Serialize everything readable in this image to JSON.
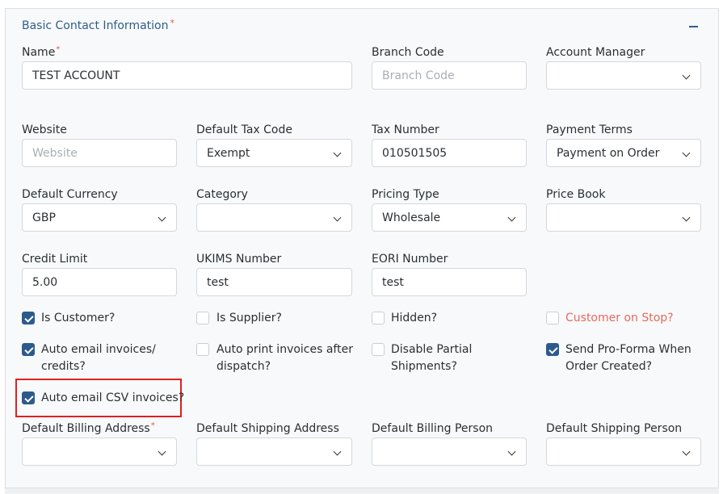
{
  "section": {
    "title": "Basic Contact Information",
    "required_mark": "*",
    "collapse_icon": "minus-icon"
  },
  "fields": {
    "name": {
      "label": "Name",
      "required_mark": "*",
      "value": "TEST ACCOUNT"
    },
    "branch_code": {
      "label": "Branch Code",
      "placeholder": "Branch Code"
    },
    "account_manager": {
      "label": "Account Manager",
      "value": ""
    },
    "website": {
      "label": "Website",
      "placeholder": "Website"
    },
    "default_tax_code": {
      "label": "Default Tax Code",
      "value": "Exempt"
    },
    "tax_number": {
      "label": "Tax Number",
      "value": "010501505"
    },
    "payment_terms": {
      "label": "Payment Terms",
      "value": "Payment on Order"
    },
    "default_currency": {
      "label": "Default Currency",
      "value": "GBP"
    },
    "category": {
      "label": "Category",
      "value": ""
    },
    "pricing_type": {
      "label": "Pricing Type",
      "value": "Wholesale"
    },
    "price_book": {
      "label": "Price Book",
      "value": ""
    },
    "credit_limit": {
      "label": "Credit Limit",
      "value": "5.00"
    },
    "ukims_number": {
      "label": "UKIMS Number",
      "value": "test"
    },
    "eori_number": {
      "label": "EORI Number",
      "value": "test"
    },
    "default_billing_address": {
      "label": "Default Billing Address",
      "required_mark": "*",
      "value": ""
    },
    "default_shipping_address": {
      "label": "Default Shipping Address",
      "value": ""
    },
    "default_billing_person": {
      "label": "Default Billing Person",
      "value": ""
    },
    "default_shipping_person": {
      "label": "Default Shipping Person",
      "value": ""
    }
  },
  "checkboxes": {
    "is_customer": {
      "label": "Is Customer?",
      "checked": true
    },
    "is_supplier": {
      "label": "Is Supplier?",
      "checked": false
    },
    "hidden": {
      "label": "Hidden?",
      "checked": false
    },
    "customer_on_stop": {
      "label": "Customer on Stop?",
      "checked": false
    },
    "auto_email_invoices": {
      "line1": "Auto email invoices/",
      "line2": "credits?",
      "checked": true
    },
    "auto_print_invoices": {
      "line1": "Auto print invoices after",
      "line2": "dispatch?",
      "checked": false
    },
    "disable_partial_shipments": {
      "line1": "Disable Partial",
      "line2": "Shipments?",
      "checked": false
    },
    "send_proforma": {
      "line1": "Send Pro-Forma When",
      "line2": "Order Created?",
      "checked": true
    },
    "auto_email_csv": {
      "label": "Auto email CSV invoices?",
      "checked": true
    }
  },
  "colors": {
    "accent": "#2d5a8c",
    "danger": "#e36b5d",
    "highlight": "#e02020"
  }
}
